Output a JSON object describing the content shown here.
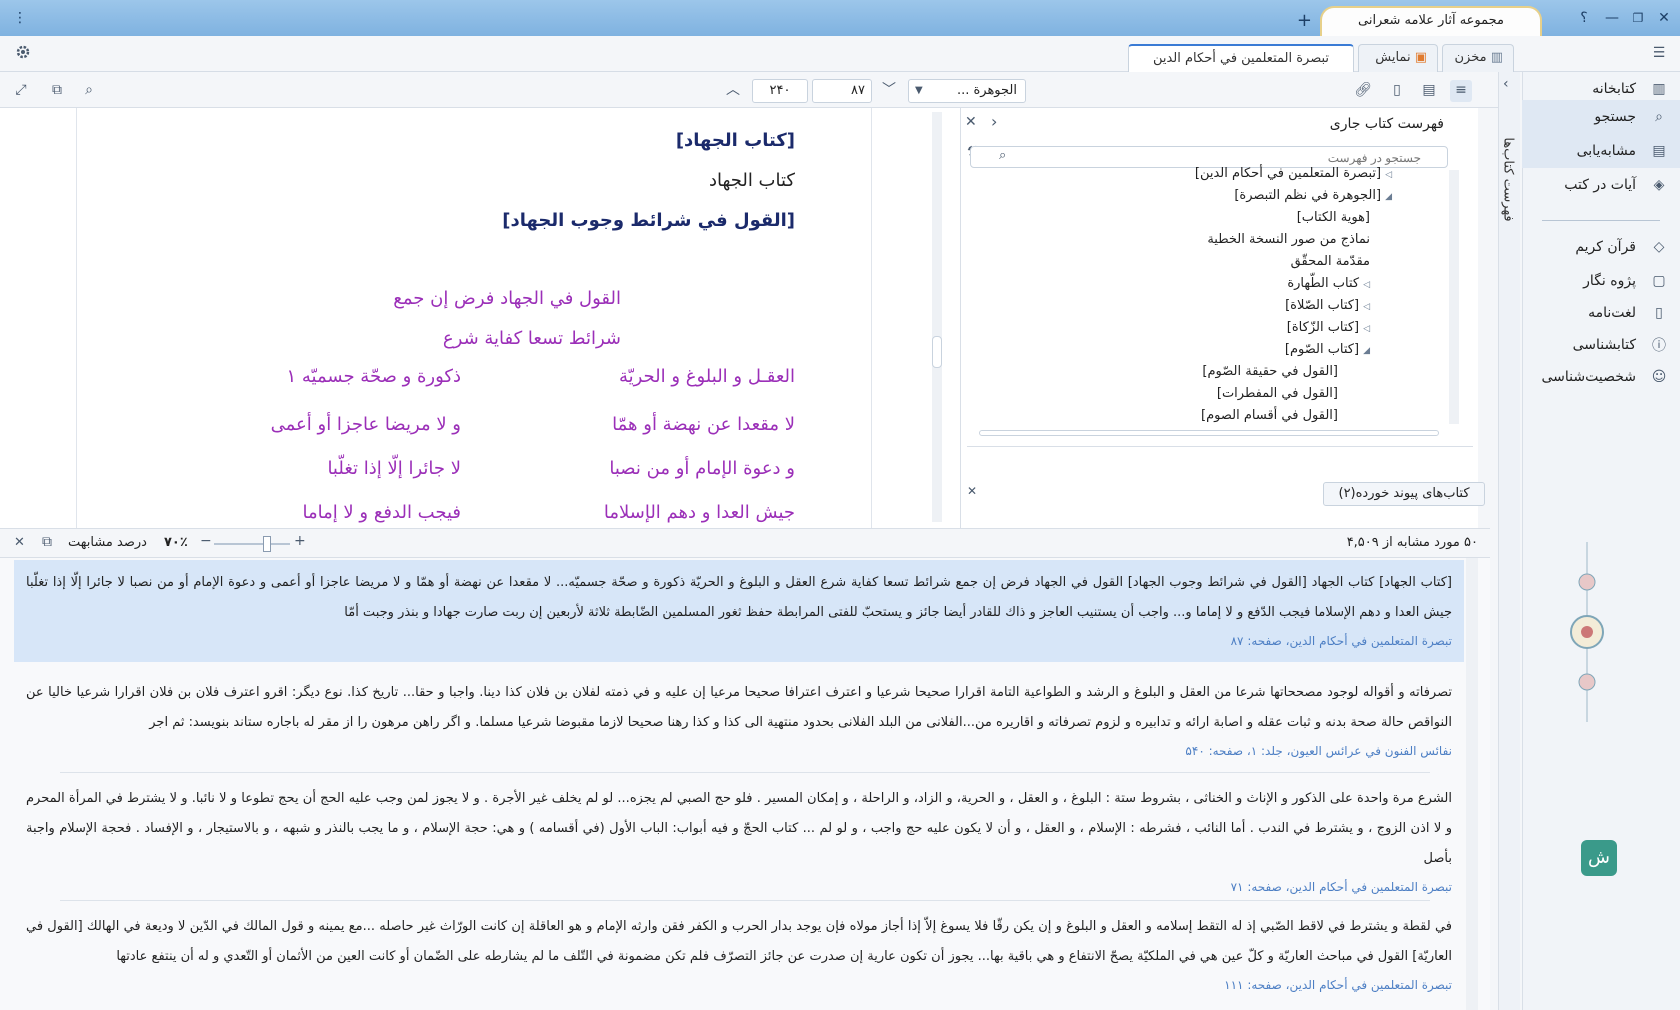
{
  "app": {
    "title": "مجموعه آثار علامه شعرانی",
    "new_tab": "+",
    "win_buttons": [
      "؟",
      "—",
      "❐",
      "✕"
    ],
    "menu": "⋮"
  },
  "tabs": [
    {
      "label": "مخزن"
    },
    {
      "label": "نمایش"
    },
    {
      "label": "تبصرة المتعلمين في أحكام الدين"
    }
  ],
  "sidebar": {
    "items": [
      {
        "label": "کتابخانه",
        "icon": "books-icon"
      },
      {
        "label": "جستجو",
        "icon": "search-icon"
      },
      {
        "label": "مشابه‌یابی",
        "icon": "similar-icon"
      },
      {
        "label": "آیات در کتب",
        "icon": "quran-verse-icon"
      },
      {
        "label": "قرآن کریم",
        "icon": "quran-icon"
      },
      {
        "label": "پژوه نگار",
        "icon": "note-icon"
      },
      {
        "label": "لغت‌نامه",
        "icon": "dictionary-icon"
      },
      {
        "label": "کتابشناسی",
        "icon": "info-icon"
      },
      {
        "label": "شخصیت‌شناسی",
        "icon": "person-icon"
      }
    ],
    "vertical_tab": "فهرست کتاب‌ها"
  },
  "toolbar": {
    "book_select": "الجوهرة ...",
    "page_current": "۸۷",
    "page_total": "۲۴۰"
  },
  "tree": {
    "title": "فهرست کتاب جاری",
    "search_placeholder": "جستجو در فهرست",
    "rows": [
      {
        "label": "[تبصرة المتعلمين في أحكام الدين]",
        "toggle": "◁"
      },
      {
        "label": "[الجوهرة في نظم التبصرة]",
        "toggle": "◢"
      },
      {
        "label": "[هوية الكتاب]",
        "toggle": ""
      },
      {
        "label": "نماذج من صور النسخة الخطية",
        "toggle": ""
      },
      {
        "label": "مقدّمة المحقّق",
        "toggle": ""
      },
      {
        "label": "كتاب الطّهارة",
        "toggle": "◁"
      },
      {
        "label": "[كتاب الصّلاة]",
        "toggle": "◁"
      },
      {
        "label": "[كتاب الزّكاة]",
        "toggle": "◁"
      },
      {
        "label": "[كتاب الصّوم]",
        "toggle": "◢"
      },
      {
        "label": "[القول في حقيقة الصّوم]",
        "toggle": ""
      },
      {
        "label": "[القول في المفطرات]",
        "toggle": ""
      },
      {
        "label": "[القول في أقسام الصوم]",
        "toggle": ""
      }
    ],
    "linked_books": "کتاب‌های پیوند خورده(۲)"
  },
  "reader": {
    "heading1": "[كتاب الجهاد]",
    "line2": "كتاب الجهاد",
    "heading3": "[القول في شرائط وجوب الجهاد]",
    "verses": [
      {
        "right": "القول في الجهاد فرض إن جمع",
        "left": ""
      },
      {
        "right": "شرائط تسعا كفاية شرع",
        "left": ""
      },
      {
        "right": "العقـل و البلوغ و الحريّة",
        "left": "ذكورة و صحّة جسميّه ١"
      },
      {
        "right": "لا مقعدا عن نهضة أو همّا",
        "left": "و لا مريضا عاجزا أو أعمى"
      },
      {
        "right": "و دعوة الإمام أو من نصبا",
        "left": "لا جائرا إلّا إذا تغلّبا"
      },
      {
        "right": "جيش العدا و دهم الإسلاما",
        "left": "فيجب الدفع و لا إماما"
      }
    ]
  },
  "similarity": {
    "count_text": "۵۰ مورد مشابه از ۴,۵۰۹",
    "percent": "۷۰٪",
    "label": "درصد مشابهت",
    "slider_level": 0.7
  },
  "results": [
    {
      "text": "[كتاب الجهاد] كتاب الجهاد [القول في شرائط وجوب الجهاد] القول في الجهاد فرض إن جمع شرائط تسعا كفاية شرع العقل و البلوغ و الحريّة ذكورة و صحّة جسميّه... لا مقعدا عن نهضة أو همّا و لا مريضا عاجزا أو أعمى و دعوة الإمام أو من نصبا لا جائرا إلّا إذا تغلّبا جيش العدا و دهم الإسلاما فيجب الدّفع و لا إماما و... واجب أن يستنيب العاجز و ذاك للقادر أيضا جائز و يستحبّ للفتى المرابطة حفظ ثغور المسلمين الضّابطة ثلاثة لأربعين إن ربت صارت جهادا و بنذر وجبت أمّا",
      "source": "تبصرة المتعلمين في أحكام الدين، صفحه: ۸۷"
    },
    {
      "text": "تصرفاته و أقواله لوجود مصححاتها شرعا من العقل و البلوغ و الرشد و الطواعية التامة اقرارا صحيحا شرعيا و اعترف اعترافا صحيحا مرعيا إن عليه و في ذمته لفلان بن فلان كذا دينا. واجبا و حقا... تاريخ كذا. نوع ديگر: اقرو اعترف فلان بن فلان اقرارا شرعيا خاليا عن النواقص حالة صحة بدنه و ثبات عقله و اصابة ارائه و تدابيره و لزوم تصرفاته و اقاريره من...الفلانى من البلد الفلانى بحدود منتهية الى كذا و كذا رهنا صحيحا لازما مقبوضا شرعيا مسلما. و اگر راهن مرهون را از مقر له باجاره ستاند بنويسد: ثم اجر",
      "source": "نفائس الفنون في عرائس العيون، جلد: ۱، صفحه: ۵۴۰"
    },
    {
      "text": "الشرع مرة واحدة على الذكور و الإناث و الخناثى ، بشروط ستة : البلوغ ، و العقل ، و الحرية، و الزاد، و الراحلة ، و إمكان المسير . فلو حج الصبي لم يجزه... لو لم يخلف غير الأجرة . و لا يجوز لمن وجب عليه الحج أن يحج تطوعا و لا نائبا. و لا يشترط في المرأة المحرم و لا اذن الزوج ، و يشترط في الندب . أما النائب ، فشرطه : الإسلام ، و العقل ، و أن لا يكون عليه حج واجب ، و لو لم ... كتاب الحجّ و فيه أبواب: الباب الأول (في أقسامه ) و هي: حجة الإسلام ، و ما يجب بالنذر و شبهه ، و بالاستيجار ، و الإفساد . فحجة الإسلام واجبة بأصل",
      "source": "تبصرة المتعلمين في أحكام الدين، صفحه: ۷۱"
    },
    {
      "text": "في لقطة و يشترط في لاقط الصّبي إذ له التقط إسلامه و العقل و البلوغ و إن يكن رقّا فلا يسوغ إلاّ إذا أجاز مولاه فإن يوجد بدار الحرب و الكفر فقن وارثه الإمام و هو العاقلة إن كانت الورّاث غير حاصله ...مع يمينه و قول المالك في الدّين لا وديعة في الهالك [القول في العاريّة] القول في مباحث العاريّة و كلّ عين هي في الملكيّة يصحّ الانتفاع و هي باقية بها... يجوز أن تكون عارية إن صدرت عن جائز التصرّف فلم تكن مضمونة في التّلف ما لم يشارطه على الضّمان أو كانت العين من الأثمان أو التّعدي و له أن ينتفع عادتها",
      "source": "تبصرة المتعلمين في أحكام الدين، صفحه: ۱۱۱"
    }
  ]
}
